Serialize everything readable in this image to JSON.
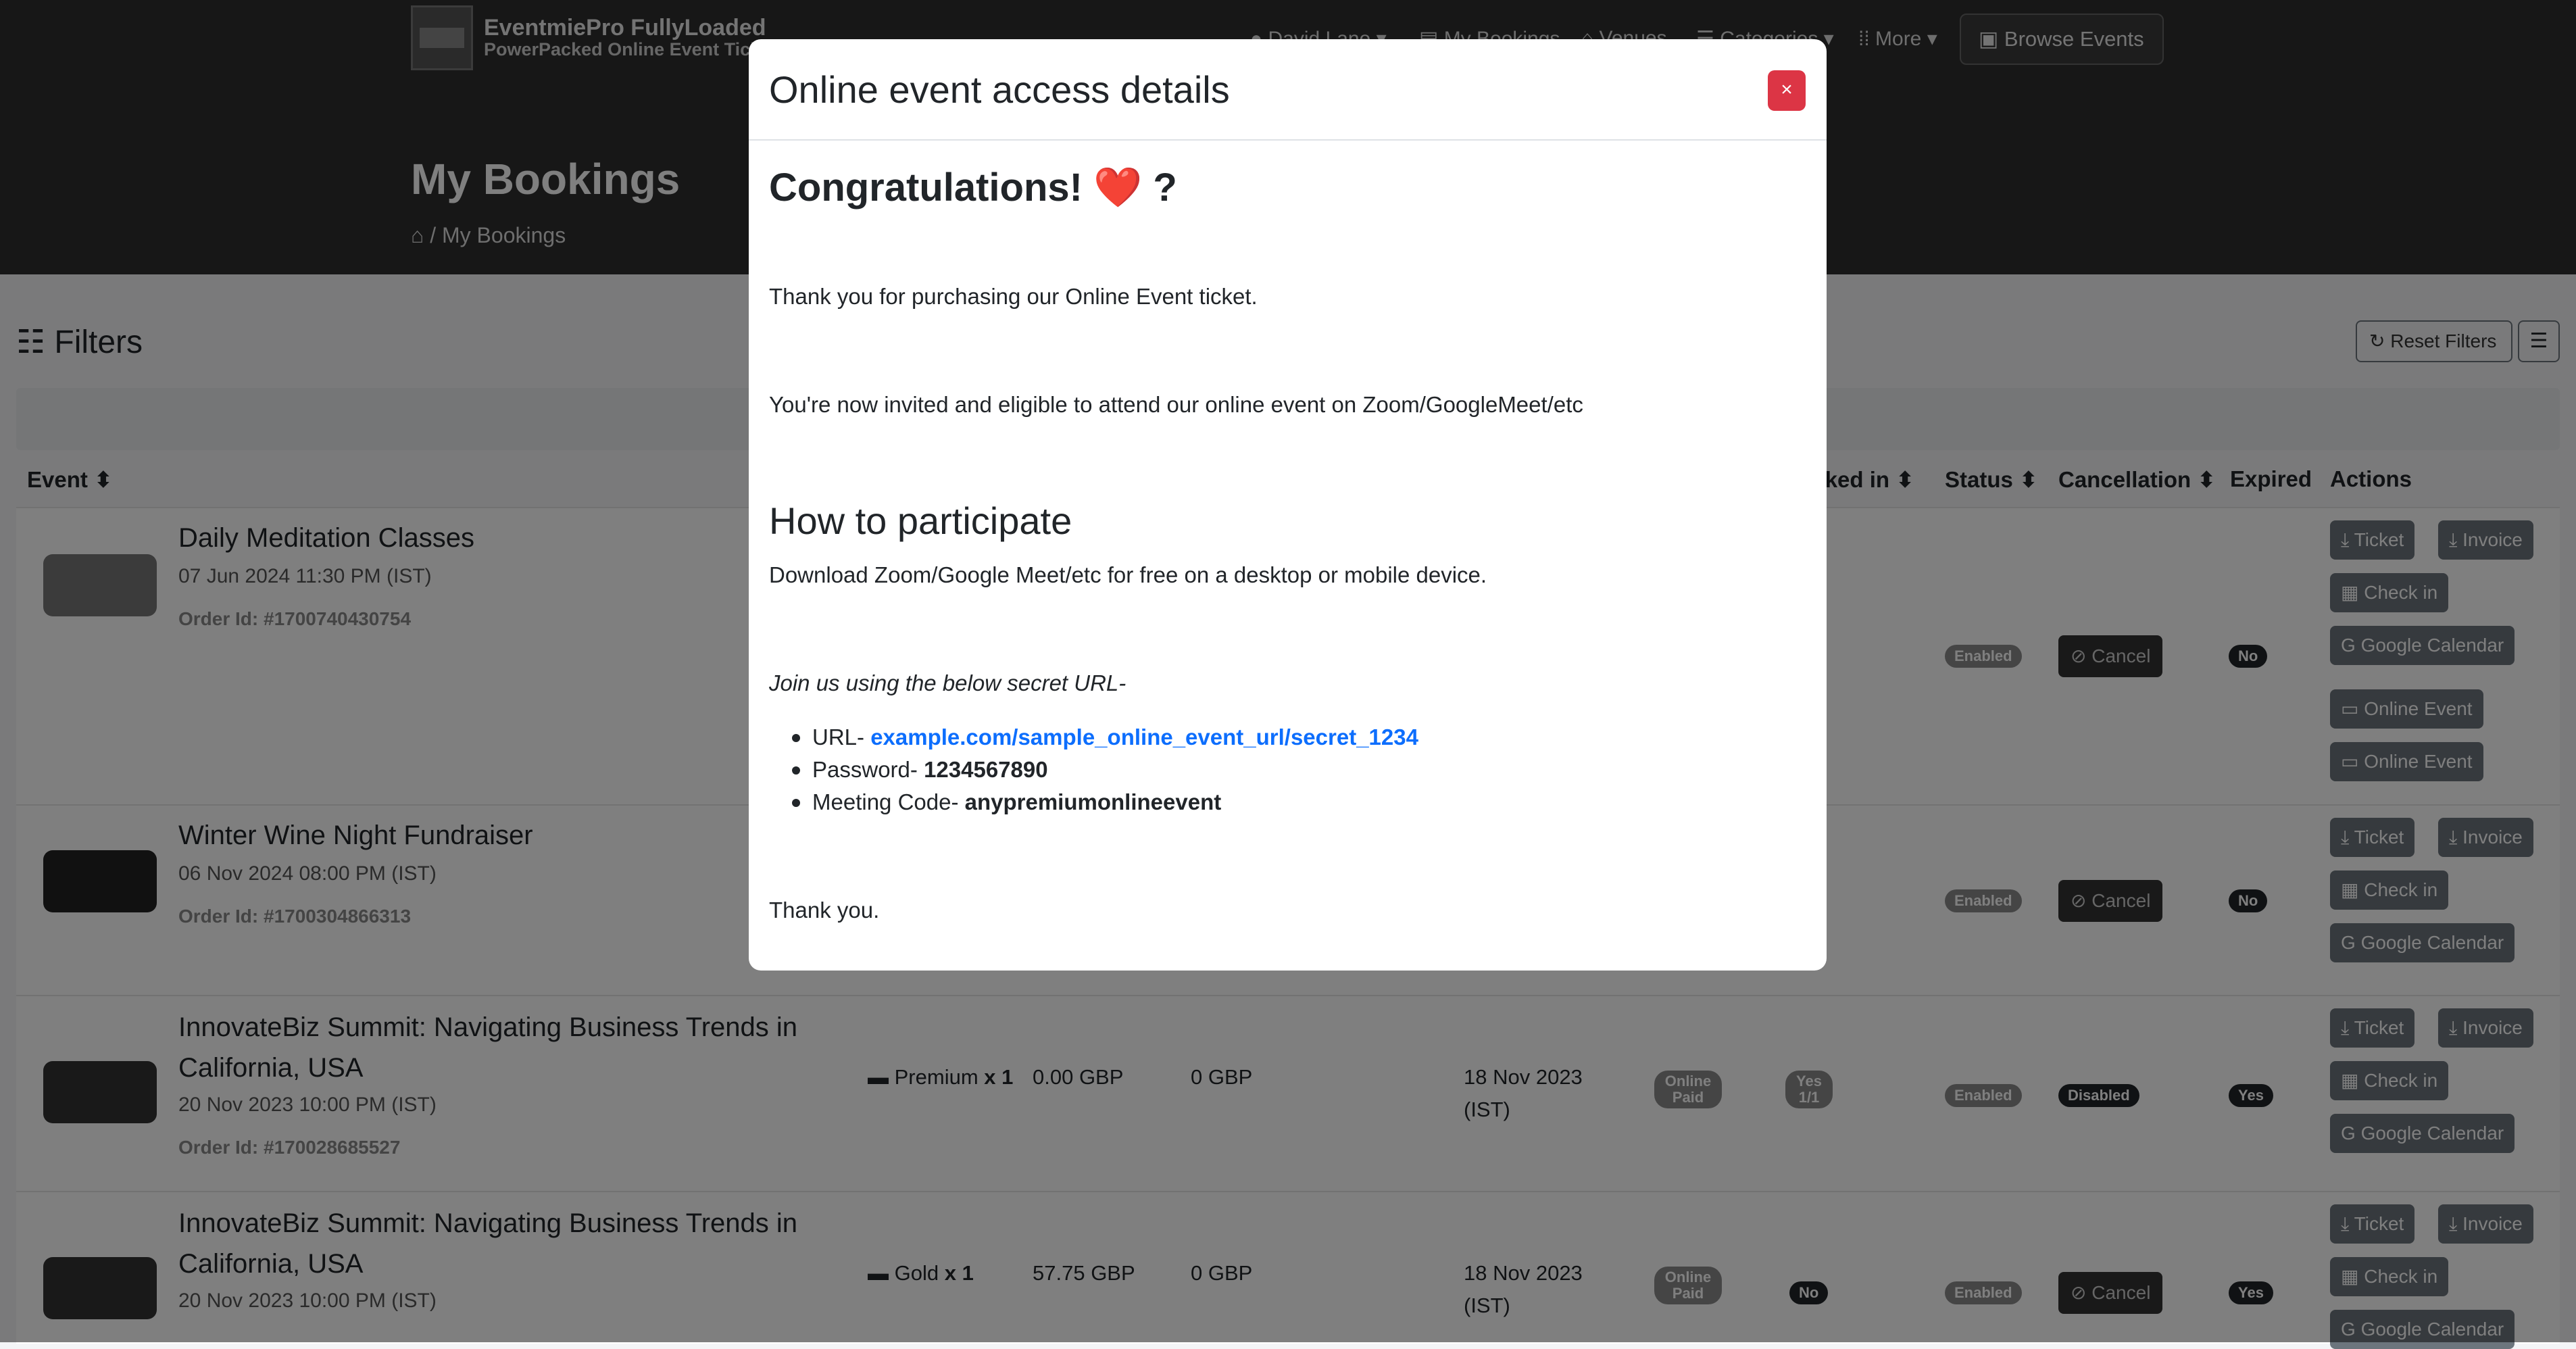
{
  "header": {
    "brand_name": "EventmiePro FullyLoaded",
    "brand_tagline": "PowerPacked Online Event Ticketing",
    "nav": [
      "David Lane",
      "My Bookings",
      "Venues",
      "Categories",
      "More"
    ],
    "browse_label": "Browse Events",
    "page_title": "My Bookings",
    "breadcrumb": "My Bookings"
  },
  "filters": {
    "title": "Filters",
    "reset_label": "Reset Filters"
  },
  "table": {
    "headers": {
      "event": "Event",
      "checked_in": "Checked in",
      "status": "Status",
      "cancellation": "Cancellation",
      "expired": "Expired",
      "actions": "Actions"
    },
    "rows": [
      {
        "title": "Daily Meditation Classes",
        "date": "07 Jun 2024 11:30 PM (IST)",
        "order": "Order Id: #1700740430754",
        "status": "Enabled",
        "cancellation": "Cancel",
        "expired": "No",
        "actions": [
          "Ticket",
          "Invoice",
          "Check in",
          "Google Calendar",
          "Online Event",
          "Online Event"
        ]
      },
      {
        "title": "Winter Wine Night Fundraiser",
        "date": "06 Nov 2024 08:00 PM (IST)",
        "order": "Order Id: #1700304866313",
        "status": "Enabled",
        "cancellation": "Cancel",
        "expired": "No",
        "actions": [
          "Ticket",
          "Invoice",
          "Check in",
          "Google Calendar"
        ]
      },
      {
        "title": "InnovateBiz Summit: Navigating Business Trends in California, USA",
        "date": "20 Nov 2023 10:00 PM (IST)",
        "order": "Order Id: #170028685527",
        "ticket": "Premium",
        "qty": "x 1",
        "price": "0.00 GBP",
        "tax": "0 GBP",
        "booked_on": "18 Nov 2023 (IST)",
        "payment": "Online Paid",
        "checked_in": "Yes 1/1",
        "status": "Enabled",
        "cancellation": "Disabled",
        "expired": "Yes",
        "actions": [
          "Ticket",
          "Invoice",
          "Check in",
          "Google Calendar"
        ]
      },
      {
        "title": "InnovateBiz Summit: Navigating Business Trends in California, USA",
        "date": "20 Nov 2023 10:00 PM (IST)",
        "ticket": "Gold",
        "qty": "x 1",
        "price": "57.75 GBP",
        "tax": "0 GBP",
        "booked_on": "18 Nov 2023 (IST)",
        "payment": "Online Paid",
        "checked_in": "No",
        "status": "Enabled",
        "cancellation": "Cancel",
        "expired": "Yes",
        "actions": [
          "Ticket",
          "Invoice",
          "Check in",
          "Google Calendar"
        ]
      }
    ]
  },
  "modal": {
    "title": "Online event access details",
    "close_label": "×",
    "heading": "Congratulations! ❤️ ?",
    "p1": "Thank you for purchasing our Online Event ticket.",
    "p2": "You're now invited and eligible to attend our online event on Zoom/GoogleMeet/etc",
    "h3": "How to participate",
    "p3": "Download Zoom/Google Meet/etc for free on a desktop or mobile device.",
    "p4": "Join us using the below secret URL-",
    "url_label": "URL- ",
    "url_value": "example.com/sample_online_event_url/secret_1234",
    "password_label": "Password- ",
    "password_value": "1234567890",
    "meeting_label": "Meeting Code- ",
    "meeting_value": "anypremiumonlineevent",
    "thanks": "Thank you.",
    "colors": {
      "close": "#dc3545",
      "link": "#0d6efd"
    }
  }
}
